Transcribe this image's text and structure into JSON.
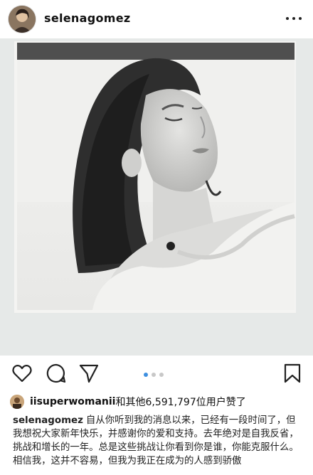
{
  "header": {
    "username": "selenagomez",
    "more_icon": "more-horizontal-icon"
  },
  "post": {
    "image_description_icon": "photo",
    "carousel": {
      "total": 3,
      "active": 1
    }
  },
  "actions": {
    "like_icon": "heart-icon",
    "comment_icon": "comment-icon",
    "share_icon": "send-icon",
    "save_icon": "bookmark-icon"
  },
  "likes": {
    "liker": "iisuperwomanii",
    "text": "和其他6,591,797位用户赞了"
  },
  "caption": {
    "username": "selenagomez",
    "text": "自从你听到我的消息以来，已经有一段时间了，但我想祝大家新年快乐，并感谢你的爱和支持。去年绝对是自我反省，挑战和增长的一年。总是这些挑战让你看到你是谁，你能克服什么。相信我，这并不容易，但我为我正在成为的人感到骄傲"
  },
  "colors": {
    "accent_dot": "#3d8fe0",
    "inactive_dot": "#c8c8c8"
  }
}
